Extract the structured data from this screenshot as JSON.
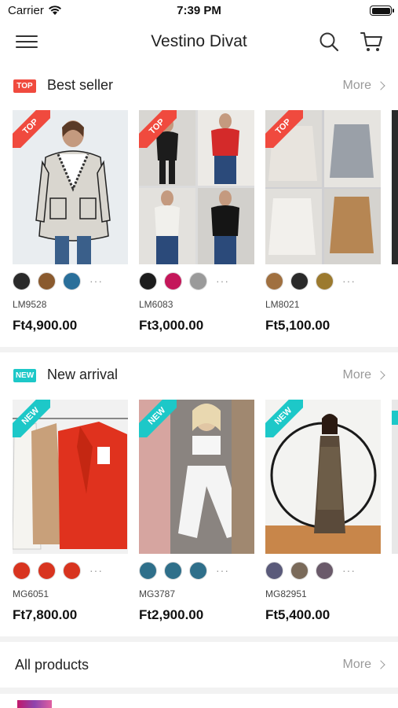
{
  "status_bar": {
    "carrier": "Carrier",
    "time": "7:39 PM"
  },
  "nav": {
    "title": "Vestino Divat"
  },
  "sections": {
    "best_seller": {
      "badge": "TOP",
      "title": "Best seller",
      "more": "More",
      "corner_label": "TOP",
      "products": [
        {
          "code": "LM9528",
          "price": "Ft4,900.00",
          "swatches": [
            "#2a2a2a",
            "#8a5a2e",
            "#2a6f9a"
          ]
        },
        {
          "code": "LM6083",
          "price": "Ft3,000.00",
          "swatches": [
            "#1c1c1c",
            "#c4175a",
            "#9a9a9a"
          ]
        },
        {
          "code": "LM8021",
          "price": "Ft5,100.00",
          "swatches": [
            "#a07040",
            "#2a2a2a",
            "#9c7a2f"
          ]
        }
      ]
    },
    "new_arrival": {
      "badge": "NEW",
      "title": "New arrival",
      "more": "More",
      "corner_label": "NEW",
      "products": [
        {
          "code": "MG6051",
          "price": "Ft7,800.00",
          "swatches": [
            "#d8341f",
            "#d8341f",
            "#d8341f"
          ]
        },
        {
          "code": "MG3787",
          "price": "Ft2,900.00",
          "swatches": [
            "#2f6f8a",
            "#2f6f8a",
            "#2f6f8a"
          ]
        },
        {
          "code": "MG82951",
          "price": "Ft5,400.00",
          "swatches": [
            "#5a5a7a",
            "#7a6a5a",
            "#6a5a6a"
          ]
        }
      ]
    }
  },
  "all_products": {
    "title": "All products",
    "more": "More"
  },
  "swatch_more": "···"
}
